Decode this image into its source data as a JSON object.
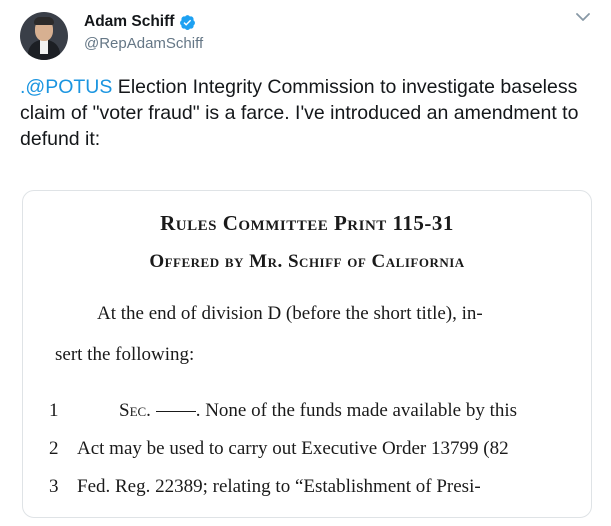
{
  "tweet": {
    "author_name": "Adam Schiff",
    "handle": "@RepAdamSchiff",
    "text_mention": ".@POTUS",
    "text_body": " Election Integrity Commission to investigate baseless claim of \"voter fraud\" is a farce. I've introduced an amendment to defund it:"
  },
  "document": {
    "title": "Rules Committee Print 115-31",
    "subtitle": "Offered by Mr. Schiff of California",
    "para1": "At the end of division D (before the short title), in-",
    "para2": "sert the following:",
    "lines": [
      {
        "num": "1",
        "prefix": "Sec.",
        "text": ". None of the funds made available by this"
      },
      {
        "num": "2",
        "text": "Act may be used to carry out Executive Order 13799 (82"
      },
      {
        "num": "3",
        "text": "Fed. Reg. 22389; relating to “Establishment of Presi-"
      }
    ]
  },
  "colors": {
    "link": "#1b95e0",
    "verified": "#1da1f2",
    "secondary_text": "#657786"
  },
  "icons": [
    "verified-badge-icon",
    "chevron-down-icon"
  ]
}
